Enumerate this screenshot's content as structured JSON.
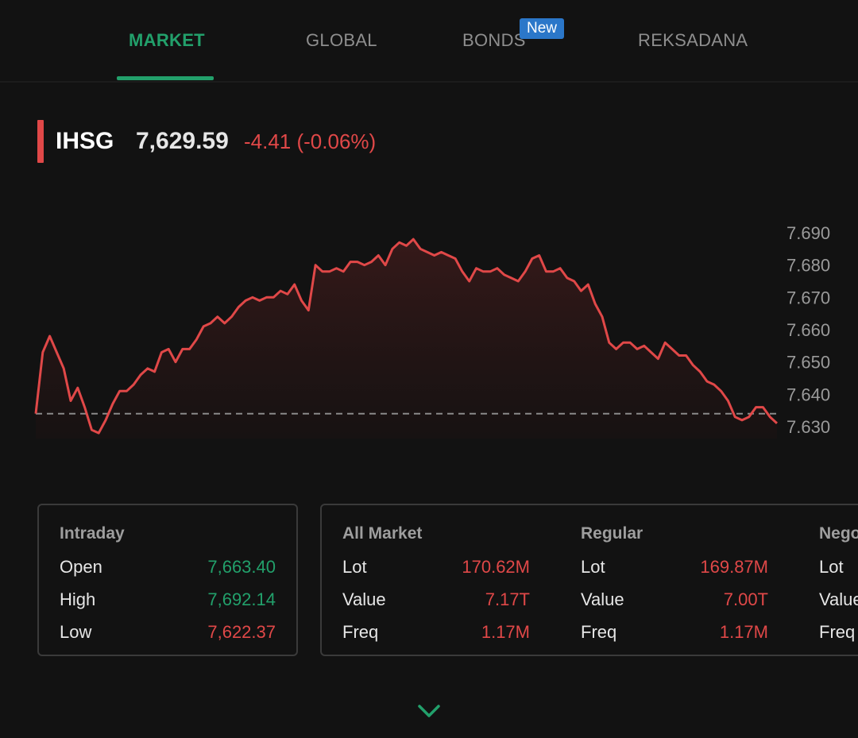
{
  "tabs": [
    {
      "label": "MARKET",
      "active": true
    },
    {
      "label": "GLOBAL",
      "active": false
    },
    {
      "label": "BONDS",
      "active": false,
      "badge": "New"
    },
    {
      "label": "REKSADANA",
      "active": false
    }
  ],
  "index": {
    "name": "IHSG",
    "value": "7,629.59",
    "change": "-4.41 (-0.06%)"
  },
  "chart_data": {
    "type": "area",
    "y_ticks": [
      "7.690",
      "7.680",
      "7.670",
      "7.660",
      "7.650",
      "7.640",
      "7.630"
    ],
    "ylim": [
      7630,
      7690
    ],
    "baseline": 7634,
    "line_color": "#e04848",
    "values": [
      7634,
      7653,
      7658,
      7653,
      7648,
      7638,
      7642,
      7636,
      7629,
      7628,
      7632,
      7637,
      7641,
      7641,
      7643,
      7646,
      7648,
      7647,
      7653,
      7654,
      7650,
      7654,
      7654,
      7657,
      7661,
      7662,
      7664,
      7662,
      7664,
      7667,
      7669,
      7670,
      7669,
      7670,
      7670,
      7672,
      7671,
      7674,
      7669,
      7666,
      7680,
      7678,
      7678,
      7679,
      7678,
      7681,
      7681,
      7680,
      7681,
      7683,
      7680,
      7685,
      7687,
      7686,
      7688,
      7685,
      7684,
      7683,
      7684,
      7683,
      7682,
      7678,
      7675,
      7679,
      7678,
      7678,
      7679,
      7677,
      7676,
      7675,
      7678,
      7682,
      7683,
      7678,
      7678,
      7679,
      7676,
      7675,
      7672,
      7674,
      7668,
      7664,
      7656,
      7654,
      7656,
      7656,
      7654,
      7655,
      7653,
      7651,
      7656,
      7654,
      7652,
      7652,
      7649,
      7647,
      7644,
      7643,
      7641,
      7638,
      7633,
      7632,
      7633,
      7636,
      7636,
      7633,
      7631
    ]
  },
  "intraday": {
    "title": "Intraday",
    "rows": [
      {
        "label": "Open",
        "value": "7,663.40",
        "color": "#22a06b"
      },
      {
        "label": "High",
        "value": "7,692.14",
        "color": "#22a06b"
      },
      {
        "label": "Low",
        "value": "7,622.37",
        "color": "#e04848"
      }
    ]
  },
  "stats": {
    "all_market": {
      "title": "All Market",
      "rows": [
        {
          "label": "Lot",
          "value": "170.62M"
        },
        {
          "label": "Value",
          "value": "7.17T"
        },
        {
          "label": "Freq",
          "value": "1.17M"
        }
      ]
    },
    "regular": {
      "title": "Regular",
      "rows": [
        {
          "label": "Lot",
          "value": "169.87M"
        },
        {
          "label": "Value",
          "value": "7.00T"
        },
        {
          "label": "Freq",
          "value": "1.17M"
        }
      ]
    },
    "negotiated": {
      "title": "Nego",
      "rows": [
        {
          "label": "Lot"
        },
        {
          "label": "Value"
        },
        {
          "label": "Freq"
        }
      ]
    }
  },
  "icons": {
    "expand": "chevron-down-icon"
  },
  "colors": {
    "accent": "#22a06b",
    "negative": "#e04848",
    "badge": "#2b77c9",
    "background": "#121212"
  }
}
